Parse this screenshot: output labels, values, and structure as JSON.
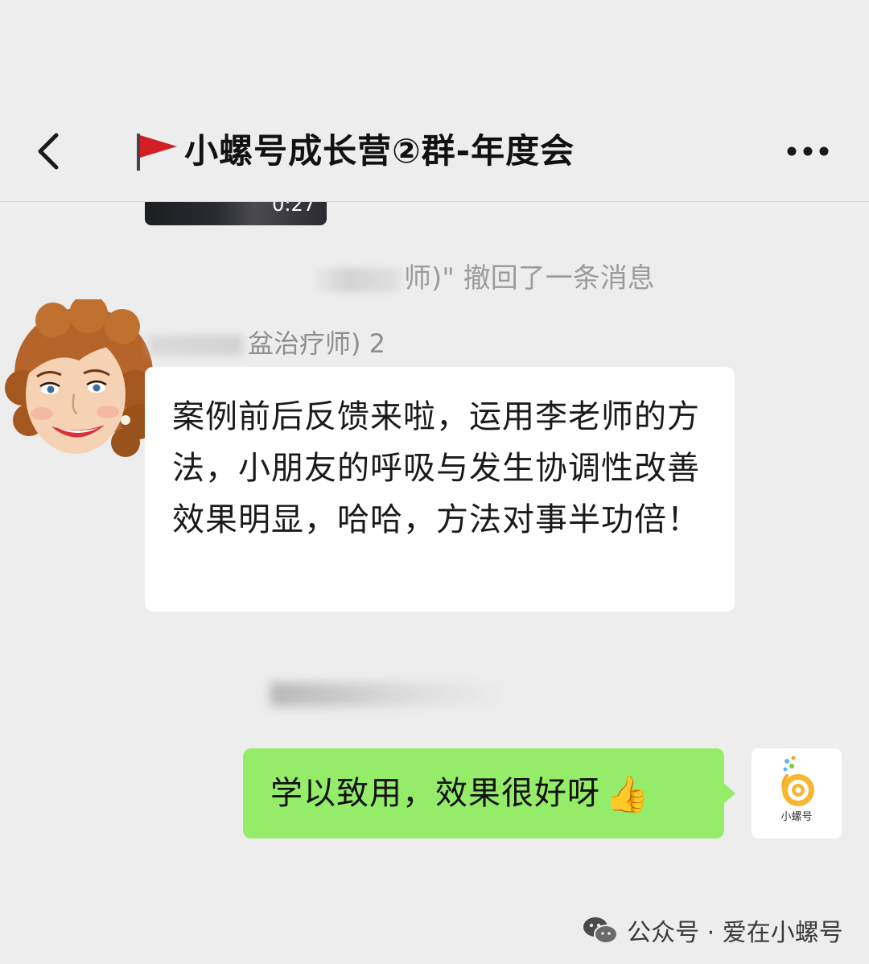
{
  "header": {
    "back_label": "<",
    "title": "小螺号成长营②群-年度会",
    "flag_color": "#d21f26"
  },
  "chat": {
    "video": {
      "duration": "0:27"
    },
    "system_notice": "师)\" 撤回了一条消息",
    "incoming": {
      "sender": "盆治疗师) 2",
      "text": "案例前后反馈来啦，运用李老师的方法，小朋友的呼吸与发生协调性改善效果明显，哈哈，方法对事半功倍！"
    },
    "outgoing": {
      "text": "学以致用，效果很好呀",
      "emoji": "👍",
      "bubble_color": "#95ec69"
    },
    "self_avatar": {
      "label": "小螺号"
    }
  },
  "watermark": {
    "text": "公众号 · 爱在小螺号"
  }
}
